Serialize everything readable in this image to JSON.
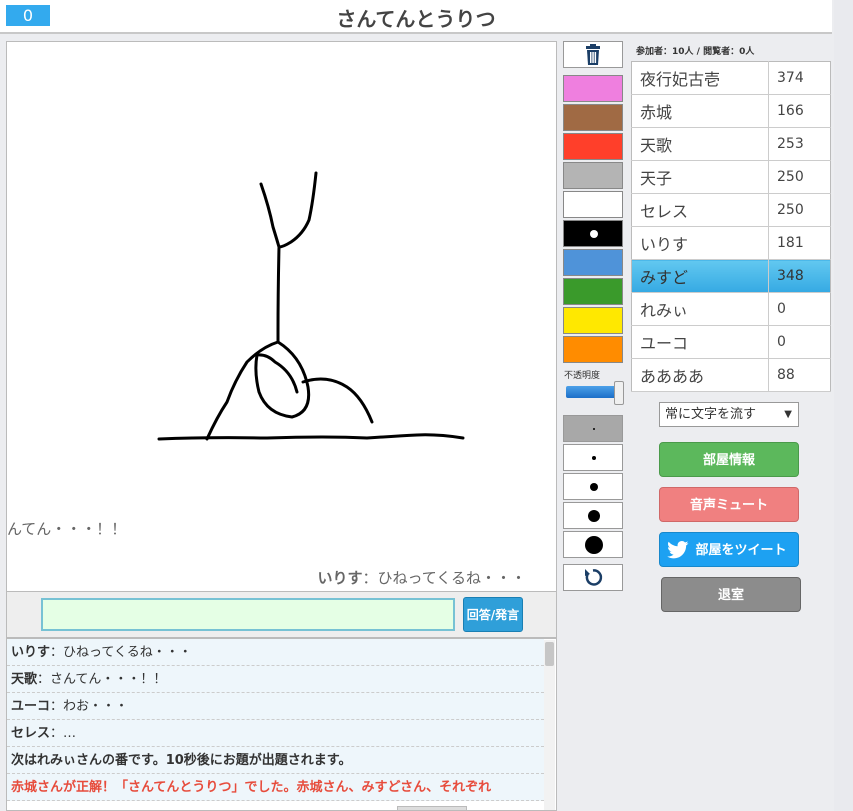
{
  "header": {
    "counter": "0",
    "title": "さんてんとうりつ"
  },
  "canvas": {
    "flow_messages": {
      "left": "んてん・・・！！",
      "right_name": "いりす",
      "right_text": "：ひねってくるね・・・"
    }
  },
  "input": {
    "value": "",
    "submit_label": "回答/発言"
  },
  "chat": [
    {
      "name": "いりす",
      "text": "：ひねってくるね・・・"
    },
    {
      "name": "天歌",
      "text": "：さんてん・・・！！"
    },
    {
      "name": "ユーコ",
      "text": "：わお・・・"
    },
    {
      "name": "セレス",
      "text": "：…"
    },
    {
      "system": "次はれみぃさんの番です。10秒後にお題が出題されます。"
    },
    {
      "answer": "赤城さんが正解！「さんてんとうりつ」でした。赤城さん、みすどさん、それぞれ"
    }
  ],
  "tools": {
    "colors": [
      "#ef7fdf",
      "#a06a44",
      "#ff3f2a",
      "#b4b4b4",
      "#ffffff",
      "#000000",
      "#4f93d9",
      "#3a9a2b",
      "#ffe800",
      "#ff8c00"
    ],
    "opacity_label": "不透明度",
    "opacity_value": 1.0
  },
  "room": {
    "participants": "参加者：10人 / 閲覧者：0人",
    "players": [
      {
        "name": "夜行妃古壱",
        "score": "374"
      },
      {
        "name": "赤城",
        "score": "166"
      },
      {
        "name": "天歌",
        "score": "253"
      },
      {
        "name": "天子",
        "score": "250"
      },
      {
        "name": "セレス",
        "score": "250"
      },
      {
        "name": "いりす",
        "score": "181"
      },
      {
        "name": "みすど",
        "score": "348"
      },
      {
        "name": "れみぃ",
        "score": "0"
      },
      {
        "name": "ユーコ",
        "score": "0"
      },
      {
        "name": "ああああ",
        "score": "88"
      }
    ],
    "flow_select": "常に文字を流す",
    "room_info_label": "部屋情報",
    "mute_label": "音声ミュート",
    "tweet_label": "部屋をツイート",
    "leave_label": "退室"
  }
}
